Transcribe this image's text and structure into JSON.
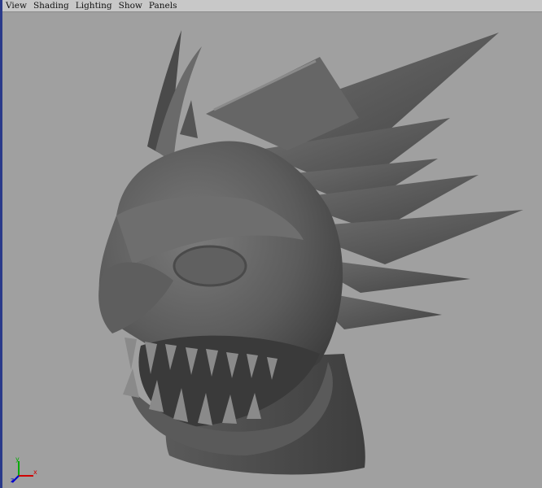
{
  "menu": {
    "items": [
      {
        "label": "View"
      },
      {
        "label": "Shading"
      },
      {
        "label": "Lighting"
      },
      {
        "label": "Show"
      },
      {
        "label": "Panels"
      }
    ]
  },
  "axis": {
    "x_label": "x",
    "y_label": "y",
    "z_label": "z"
  },
  "colors": {
    "viewport_bg": "#a0a0a0",
    "model_base": "#5a5a5a",
    "model_dark": "#3c3c3c",
    "model_light": "#7a7a7a",
    "panel_border": "#2a3a8a"
  }
}
